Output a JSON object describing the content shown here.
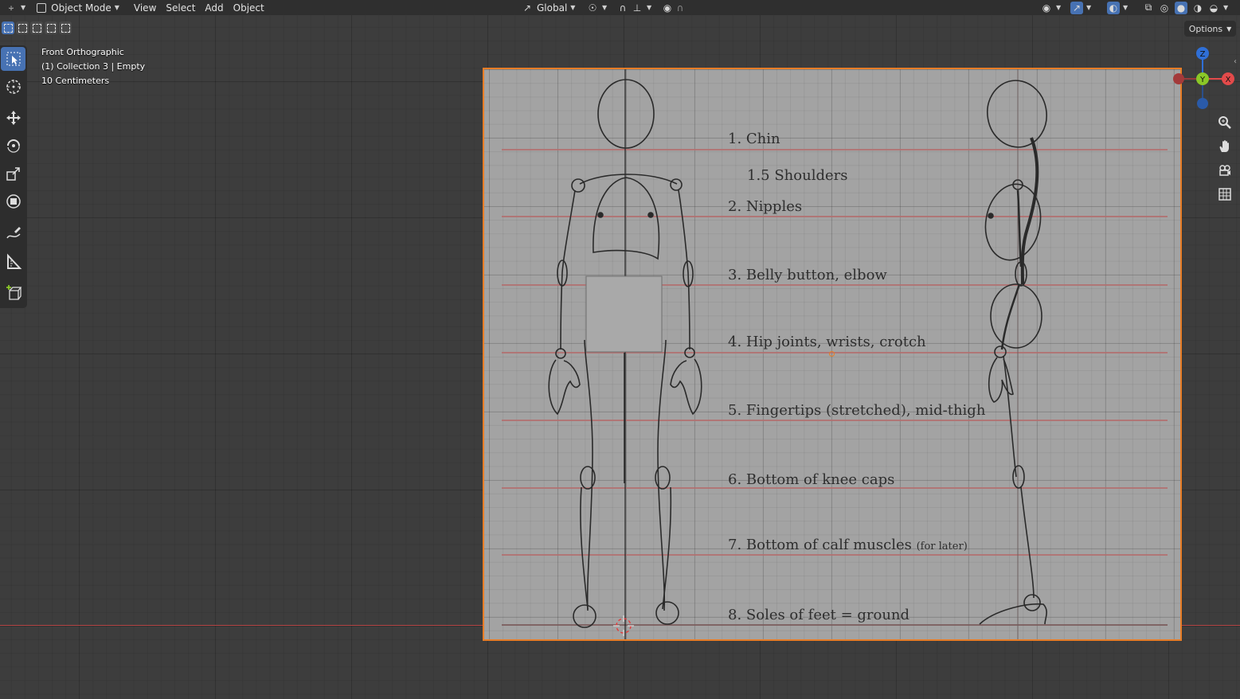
{
  "header": {
    "mode_label": "Object Mode",
    "menu": [
      "View",
      "Select",
      "Add",
      "Object"
    ],
    "orientation_label": "Global"
  },
  "overlay": {
    "view_name": "Front Orthographic",
    "collection_info": "(1) Collection 3 | Empty",
    "scale_info": "10 Centimeters"
  },
  "options_label": "Options",
  "gizmo": {
    "z": "Z",
    "y": "Y",
    "x": "X"
  },
  "reference": {
    "labels": [
      {
        "text": "1. Chin",
        "note": ""
      },
      {
        "text": "1.5 Shoulders",
        "note": ""
      },
      {
        "text": "2. Nipples",
        "note": ""
      },
      {
        "text": "3. Belly button, elbow",
        "note": ""
      },
      {
        "text": "4. Hip joints, wrists, crotch",
        "note": ""
      },
      {
        "text": "5. Fingertips (stretched), mid-thigh",
        "note": ""
      },
      {
        "text": "6. Bottom of knee caps",
        "note": ""
      },
      {
        "text": "7. Bottom of calf muscles",
        "note": "(for later)"
      },
      {
        "text": "8. Soles of feet = ground",
        "note": ""
      }
    ]
  },
  "colors": {
    "active_blue": "#4772b3",
    "selection_orange": "#e87d26",
    "axis_red": "#b44545",
    "axis_x": "#e34a4a",
    "axis_y": "#8bc727",
    "axis_z": "#2f6fd6"
  }
}
